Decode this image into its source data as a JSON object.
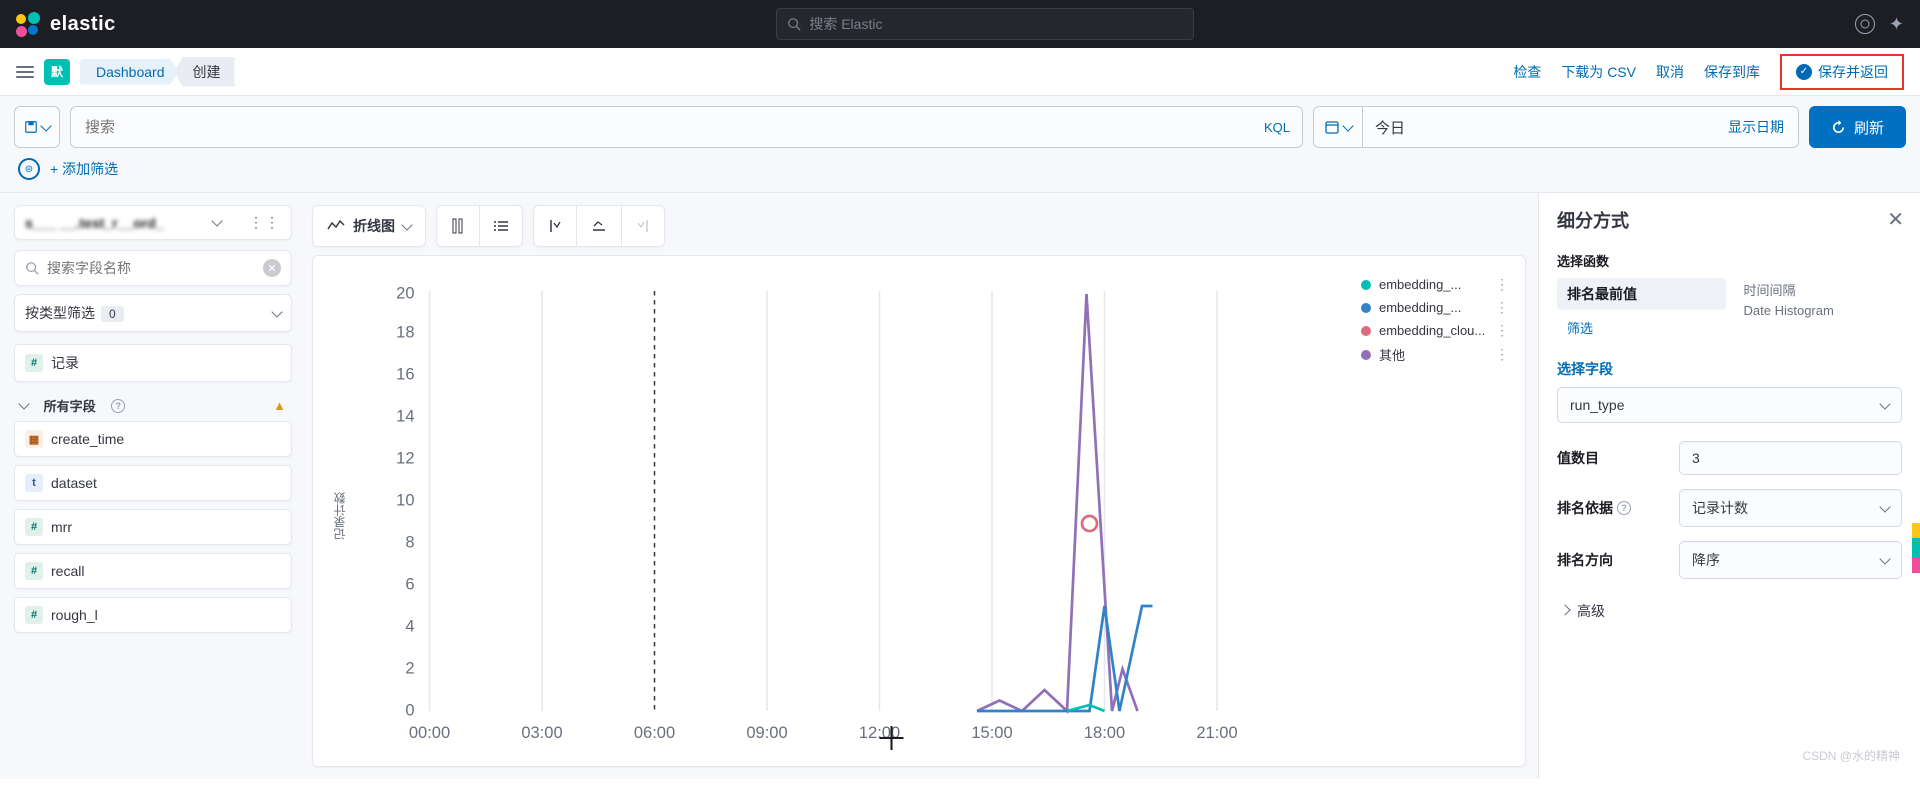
{
  "header": {
    "brand": "elastic",
    "search_placeholder": "搜索 Elastic"
  },
  "breadcrumb": {
    "badge": "默",
    "link": "Dashboard",
    "current": "创建"
  },
  "actions": {
    "inspect": "检查",
    "download_csv": "下载为 CSV",
    "cancel": "取消",
    "save_to_lib": "保存到库",
    "save_return": "保存并返回"
  },
  "query": {
    "search_placeholder": "搜索",
    "lang": "KQL",
    "date_text": "今日",
    "show_dates": "显示日期",
    "refresh": "刷新",
    "add_filter": "+ 添加筛选"
  },
  "fields_panel": {
    "datasource": "s___ __.test_r__ord_",
    "search_placeholder": "搜索字段名称",
    "type_filter_label": "按类型筛选",
    "type_count": "0",
    "records_label": "记录",
    "all_fields_label": "所有字段",
    "fields": [
      "create_time",
      "dataset",
      "mrr",
      "recall",
      "rough_l"
    ]
  },
  "chart_toolbar": {
    "type_label": "折线图"
  },
  "chart_data": {
    "type": "line",
    "ylabel": "记录计数",
    "ylim": [
      0,
      20
    ],
    "yticks": [
      0,
      2,
      4,
      6,
      8,
      10,
      12,
      14,
      16,
      18,
      20
    ],
    "x_categories": [
      "00:00",
      "03:00",
      "06:00",
      "09:00",
      "12:00",
      "15:00",
      "18:00",
      "21:00"
    ],
    "series": [
      {
        "name": "embedding_...",
        "color": "#00bfb3"
      },
      {
        "name": "embedding_...",
        "color": "#3183c8"
      },
      {
        "name": "embedding_clou...",
        "color": "#dd6b7f"
      },
      {
        "name": "其他",
        "color": "#9170b8"
      }
    ],
    "annotations": {
      "pink_marker_time": "18:00",
      "pink_marker_value": 9,
      "peak_time": "18:00",
      "peak_value": 20
    }
  },
  "right_panel": {
    "title": "细分方式",
    "func_label": "选择函数",
    "top_values": "排名最前值",
    "filter": "筛选",
    "interval": "时间间隔",
    "date_histogram": "Date Histogram",
    "select_field_label": "选择字段",
    "select_field_value": "run_type",
    "count_label": "值数目",
    "count_value": "3",
    "rank_by_label": "排名依据",
    "rank_by_value": "记录计数",
    "direction_label": "排名方向",
    "direction_value": "降序",
    "advanced": "高级"
  },
  "watermark": "CSDN @水的精神"
}
